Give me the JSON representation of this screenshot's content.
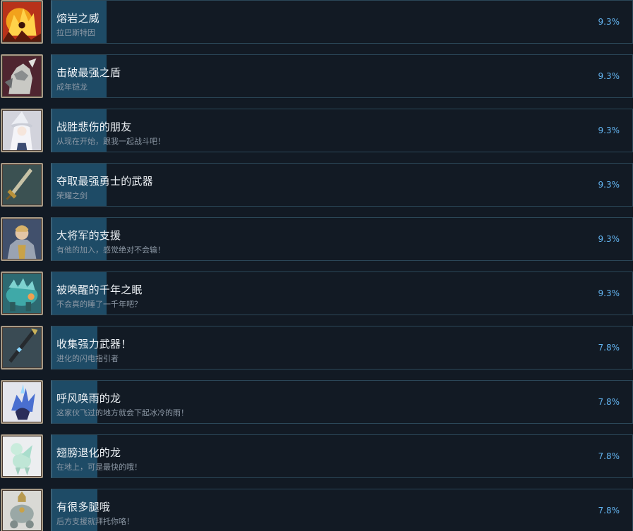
{
  "achievements": [
    {
      "title": "熔岩之威",
      "desc": "拉巴斯特因",
      "percent": "9.3%",
      "percent_value": 9.3,
      "icon": "fire-demon-icon",
      "bg": "#c8401a"
    },
    {
      "title": "击破最强之盾",
      "desc": "成年铠龙",
      "percent": "9.3%",
      "percent_value": 9.3,
      "icon": "armored-dragon-icon",
      "bg": "#5a2a33"
    },
    {
      "title": "战胜悲伤的朋友",
      "desc": "从现在开始，跟我一起战斗吧！",
      "percent": "9.3%",
      "percent_value": 9.3,
      "icon": "white-witch-icon",
      "bg": "#d8d8e0"
    },
    {
      "title": "夺取最强勇士的武器",
      "desc": "荣耀之剑",
      "percent": "9.3%",
      "percent_value": 9.3,
      "icon": "golden-sword-icon",
      "bg": "#3f5556"
    },
    {
      "title": "大将军的支援",
      "desc": "有他的加入，感觉绝对不会输！",
      "percent": "9.3%",
      "percent_value": 9.3,
      "icon": "general-knight-icon",
      "bg": "#4a5a78"
    },
    {
      "title": "被唤醒的千年之眠",
      "desc": "不会真的睡了一千年吧？",
      "percent": "9.3%",
      "percent_value": 9.3,
      "icon": "teal-beast-icon",
      "bg": "#2f6f78"
    },
    {
      "title": "收集强力武器！",
      "desc": "进化的闪电指引者",
      "percent": "7.8%",
      "percent_value": 7.8,
      "icon": "lightning-spear-icon",
      "bg": "#3d4f58"
    },
    {
      "title": "呼风唤雨的龙",
      "desc": "这家伙飞过的地方就会下起冰冷的雨！",
      "percent": "7.8%",
      "percent_value": 7.8,
      "icon": "ice-dragon-icon",
      "bg": "#e4e6ee"
    },
    {
      "title": "翅膀退化的龙",
      "desc": "在地上，可是最快的哦！",
      "percent": "7.8%",
      "percent_value": 7.8,
      "icon": "mint-dragon-icon",
      "bg": "#eef0f2"
    },
    {
      "title": "有很多腿哦",
      "desc": "后方支援就拜托你咯！",
      "percent": "7.8%",
      "percent_value": 7.8,
      "icon": "multi-leg-creature-icon",
      "bg": "#dcdcd8"
    }
  ]
}
